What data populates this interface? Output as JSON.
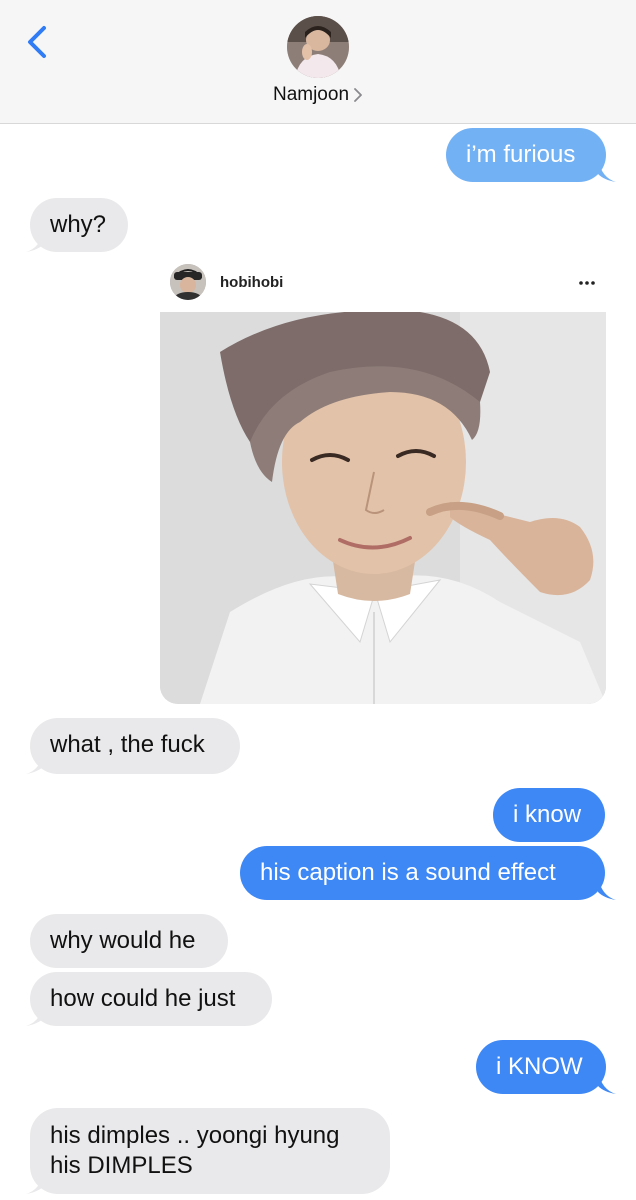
{
  "header": {
    "contact_name": "Namjoon"
  },
  "post": {
    "username": "hobihobi"
  },
  "messages": [
    {
      "side": "sent",
      "text": "i’m furious"
    },
    {
      "side": "received",
      "text": "why?"
    },
    {
      "side": "received",
      "text": "what , the fuck"
    },
    {
      "side": "sent",
      "text": "i know"
    },
    {
      "side": "sent",
      "text": "his caption is a sound effect"
    },
    {
      "side": "received",
      "text": "why would he"
    },
    {
      "side": "received",
      "text": "how could he just"
    },
    {
      "side": "sent",
      "text": "i KNOW"
    },
    {
      "side": "received",
      "text": "his dimples .. yoongi hyung"
    },
    {
      "side": "received",
      "text": "his DIMPLES"
    }
  ],
  "colors": {
    "sent_bubble": "#3e88f5",
    "sent_bubble_first": "#73b1f5",
    "received_bubble": "#e9e9eb",
    "accent": "#2f7cf6"
  }
}
